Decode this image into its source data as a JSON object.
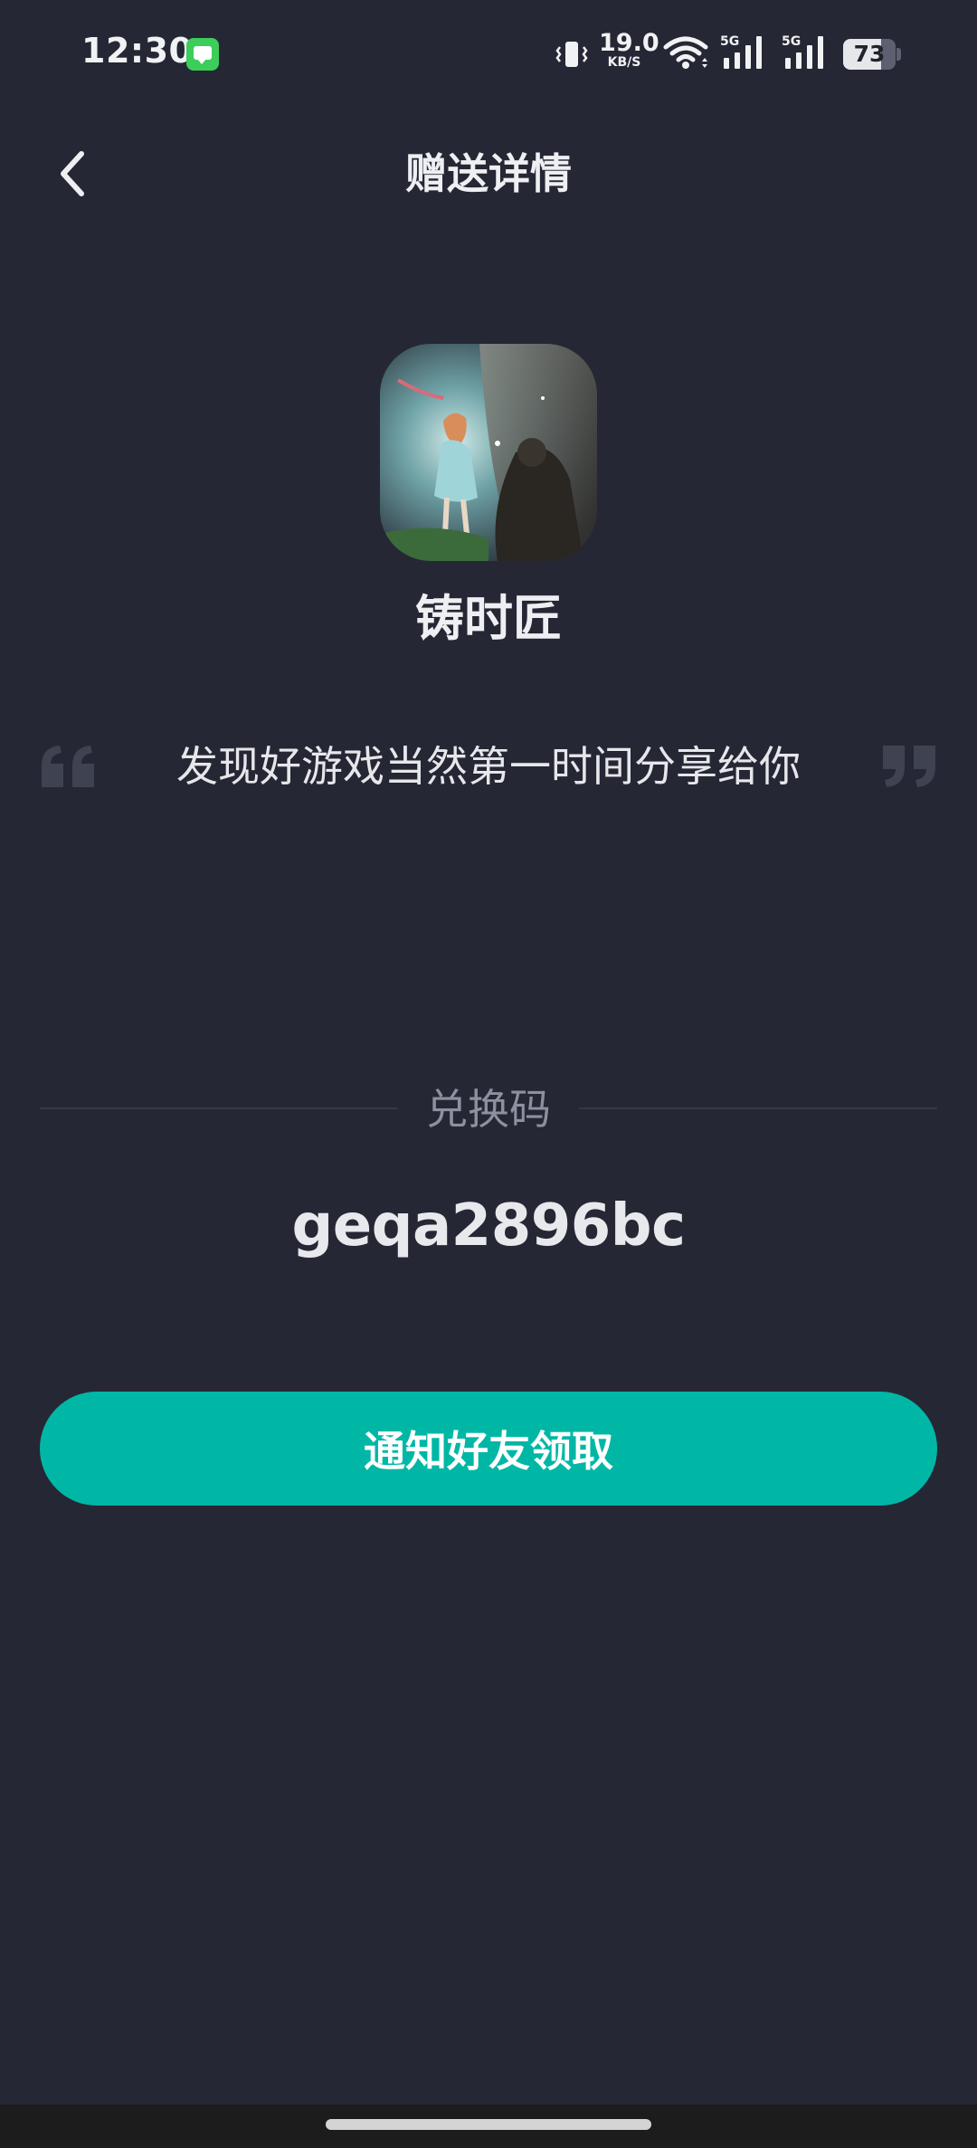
{
  "status_bar": {
    "time": "12:30",
    "notification_icon": "message-icon",
    "net_speed_value": "19.0",
    "net_speed_unit": "KB/S",
    "network_type_1": "5G",
    "network_type_2": "5G",
    "battery_level": "73"
  },
  "header": {
    "back_icon": "chevron-left-icon",
    "title": "赠送详情"
  },
  "game": {
    "name": "铸时匠"
  },
  "message": {
    "quote": "发现好游戏当然第一时间分享给你"
  },
  "redeem": {
    "label": "兑换码",
    "code": "geqa2896bc"
  },
  "actions": {
    "notify_label": "通知好友领取"
  },
  "colors": {
    "background": "#252734",
    "accent": "#00B7A6",
    "muted_text": "#8E90A0"
  }
}
